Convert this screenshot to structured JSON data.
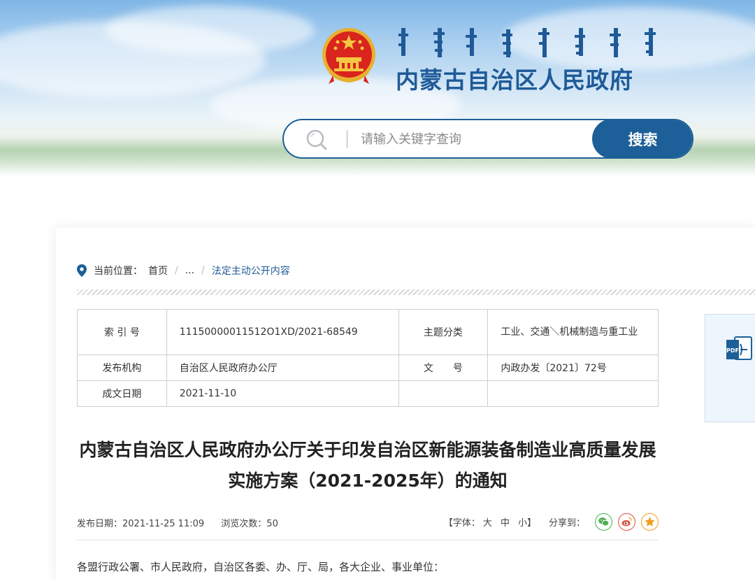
{
  "site": {
    "title": "内蒙古自治区人民政府",
    "mongolian_logo": "traditional-mongolian-script-logo",
    "emblem": "national-emblem"
  },
  "search": {
    "placeholder": "请输入关键字查询",
    "value": "",
    "button_label": "搜索",
    "icon": "search-icon"
  },
  "breadcrumb": {
    "label": "当前位置：",
    "items": [
      "首页",
      "...",
      "法定主动公开内容"
    ],
    "separator": "/",
    "icon": "location-pin-icon"
  },
  "meta_table": {
    "rows": [
      {
        "label1": "索 引 号",
        "value1": "11150000011512O1XD/2021-68549",
        "label2": "主题分类",
        "value2": "工业、交通＼机械制造与重工业"
      },
      {
        "label1": "发布机构",
        "value1": "自治区人民政府办公厅",
        "label2": "文　　号",
        "value2": "内政办发〔2021〕72号"
      },
      {
        "label1": "成文日期",
        "value1": "2021-11-10",
        "label2": "",
        "value2": ""
      }
    ]
  },
  "side_panel": {
    "icon": "pdf-icon"
  },
  "article": {
    "title": "内蒙古自治区人民政府办公厅关于印发自治区新能源装备制造业高质量发展实施方案（2021-2025年）的通知",
    "publish_date": "发布日期：2021-11-25 11:09",
    "views": "浏览次数：50",
    "font_size_label": "【字体：",
    "font_sizes": [
      "大",
      "中",
      "小"
    ],
    "font_size_close": "】",
    "share_label": "分享到：",
    "share_icons": [
      "wechat-icon",
      "weibo-icon",
      "favorite-icon"
    ],
    "salutation": "各盟行政公署、市人民政府，自治区各委、办、厅、局，各大企业、事业单位："
  },
  "colors": {
    "brand_blue": "#1d5f98",
    "title_blue": "#1f5a97",
    "wechat_green": "#4caf50",
    "weibo_red": "#e0523b",
    "favorite_orange": "#f0a01f"
  }
}
